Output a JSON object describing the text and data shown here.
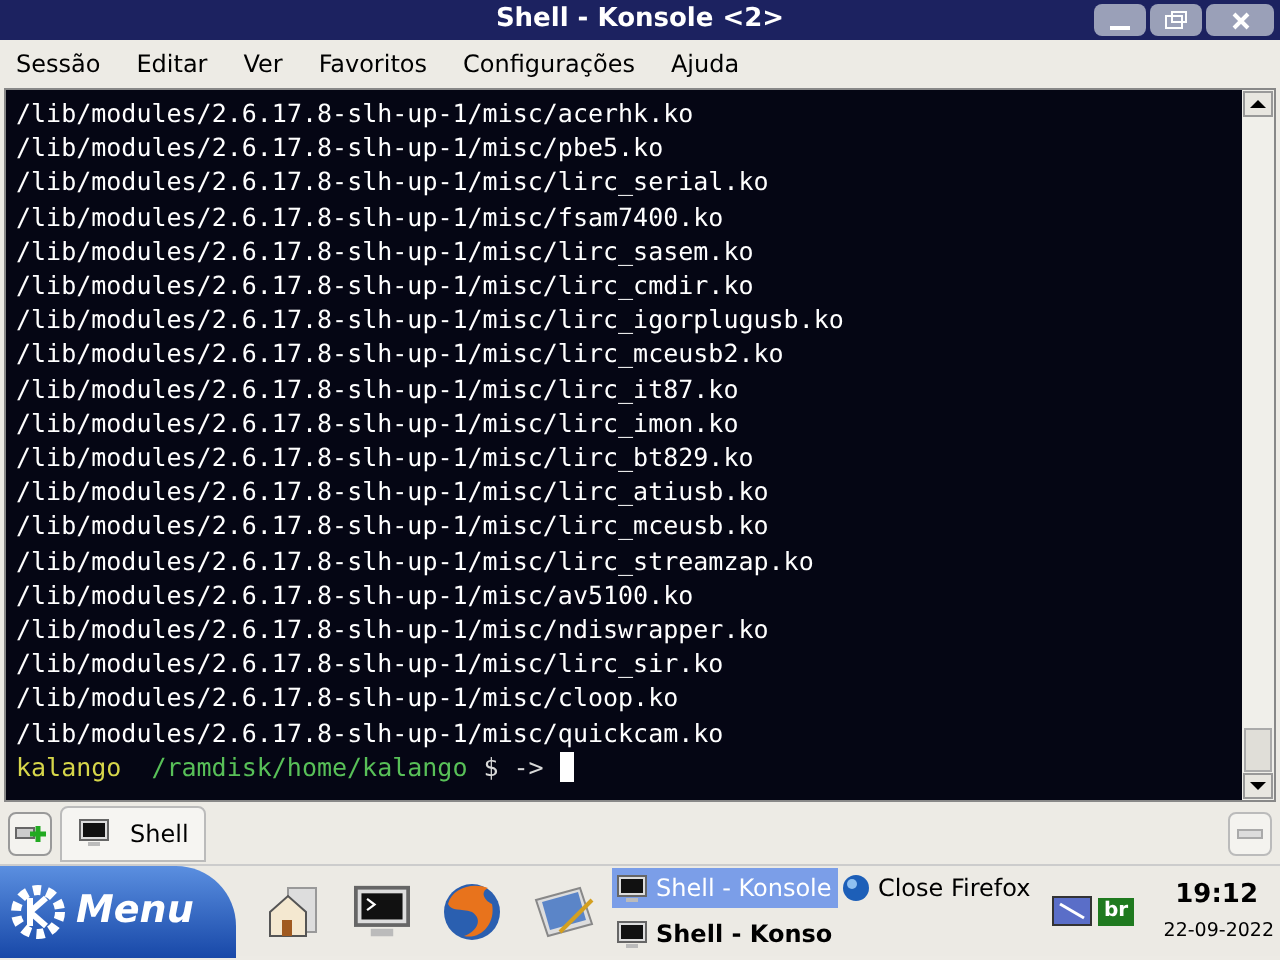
{
  "window": {
    "title": "Shell - Konsole <2>"
  },
  "menu": [
    "Sessão",
    "Editar",
    "Ver",
    "Favoritos",
    "Configurações",
    "Ajuda"
  ],
  "terminal": {
    "lines": [
      "/lib/modules/2.6.17.8-slh-up-1/misc/acerhk.ko",
      "/lib/modules/2.6.17.8-slh-up-1/misc/pbe5.ko",
      "/lib/modules/2.6.17.8-slh-up-1/misc/lirc_serial.ko",
      "/lib/modules/2.6.17.8-slh-up-1/misc/fsam7400.ko",
      "/lib/modules/2.6.17.8-slh-up-1/misc/lirc_sasem.ko",
      "/lib/modules/2.6.17.8-slh-up-1/misc/lirc_cmdir.ko",
      "/lib/modules/2.6.17.8-slh-up-1/misc/lirc_igorplugusb.ko",
      "/lib/modules/2.6.17.8-slh-up-1/misc/lirc_mceusb2.ko",
      "/lib/modules/2.6.17.8-slh-up-1/misc/lirc_it87.ko",
      "/lib/modules/2.6.17.8-slh-up-1/misc/lirc_imon.ko",
      "/lib/modules/2.6.17.8-slh-up-1/misc/lirc_bt829.ko",
      "/lib/modules/2.6.17.8-slh-up-1/misc/lirc_atiusb.ko",
      "/lib/modules/2.6.17.8-slh-up-1/misc/lirc_mceusb.ko",
      "/lib/modules/2.6.17.8-slh-up-1/misc/lirc_streamzap.ko",
      "/lib/modules/2.6.17.8-slh-up-1/misc/av5100.ko",
      "/lib/modules/2.6.17.8-slh-up-1/misc/ndiswrapper.ko",
      "/lib/modules/2.6.17.8-slh-up-1/misc/lirc_sir.ko",
      "/lib/modules/2.6.17.8-slh-up-1/misc/cloop.ko",
      "/lib/modules/2.6.17.8-slh-up-1/misc/quickcam.ko"
    ],
    "prompt": {
      "user": "kalango",
      "path": "/ramdisk/home/kalango",
      "symbol": "$ ->"
    }
  },
  "session_tabs": [
    {
      "label": "Shell",
      "selected": true
    }
  ],
  "taskbar": {
    "menu_button": "Menu",
    "tasks": [
      {
        "label": "Shell - Konsole",
        "selected": true,
        "bold": false,
        "kind": "terminal"
      },
      {
        "label": "Close Firefox",
        "selected": false,
        "bold": false,
        "kind": "globe"
      },
      {
        "label": "Shell - Konso",
        "selected": false,
        "bold": true,
        "kind": "terminal"
      }
    ],
    "tray_badge": "br",
    "clock": "19:12",
    "date": "22-09-2022"
  }
}
